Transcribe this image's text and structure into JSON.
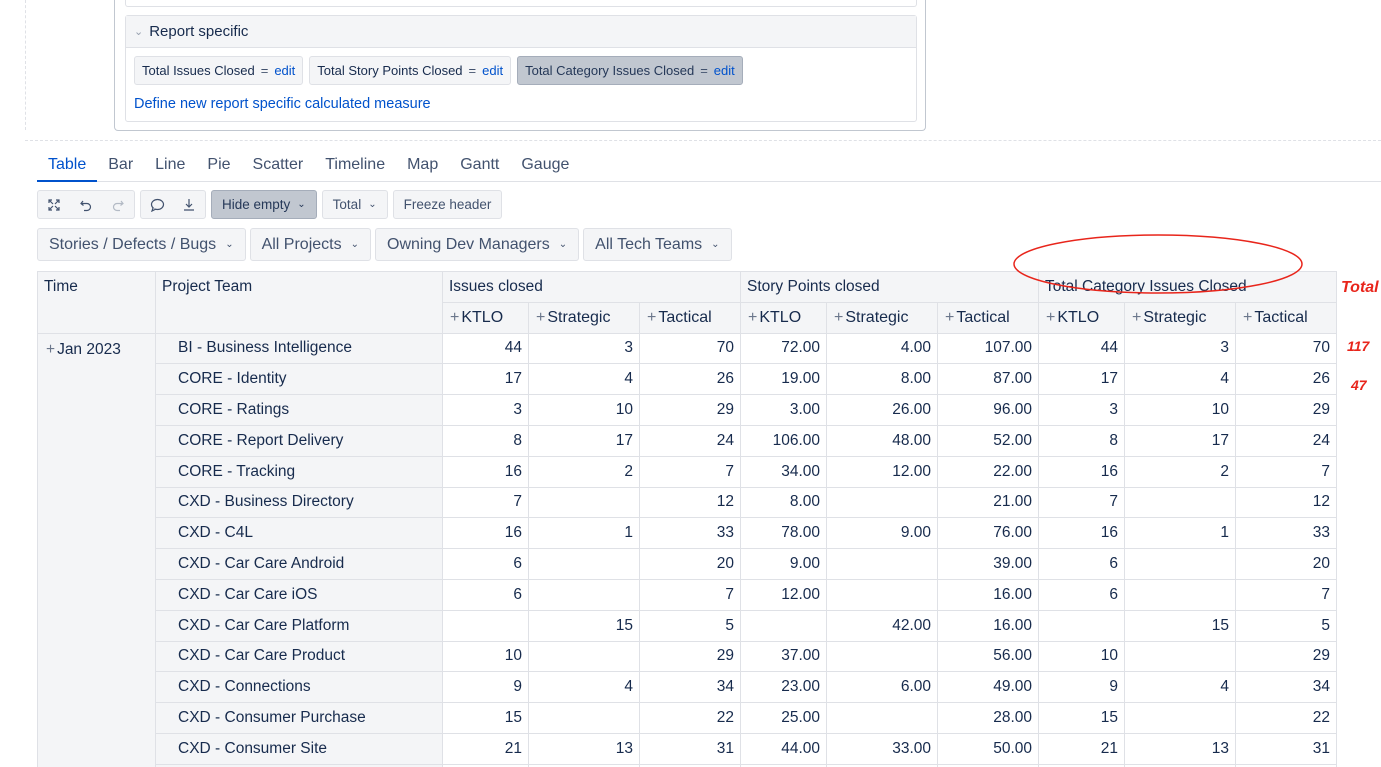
{
  "report_specific": {
    "header": "Report specific",
    "measures": [
      {
        "name": "Total Issues Closed",
        "eq": "=",
        "edit": "edit",
        "selected": false
      },
      {
        "name": "Total Story Points Closed",
        "eq": "=",
        "edit": "edit",
        "selected": false
      },
      {
        "name": "Total Category Issues Closed",
        "eq": "=",
        "edit": "edit",
        "selected": true
      }
    ],
    "define_link": "Define new report specific calculated measure"
  },
  "tabs": [
    "Table",
    "Bar",
    "Line",
    "Pie",
    "Scatter",
    "Timeline",
    "Map",
    "Gantt",
    "Gauge"
  ],
  "active_tab": "Table",
  "toolbar": {
    "icons": [
      "expand-icon",
      "undo-icon",
      "redo-icon",
      "comment-icon",
      "download-icon"
    ],
    "hide_empty": "Hide empty",
    "total": "Total",
    "freeze_header": "Freeze header"
  },
  "filters": [
    "Stories / Defects / Bugs",
    "All Projects",
    "Owning Dev Managers",
    "All Tech Teams"
  ],
  "table": {
    "col_time": "Time",
    "col_team": "Project Team",
    "groups": [
      "Issues closed",
      "Story Points closed",
      "Total Category Issues Closed"
    ],
    "sub_cols": [
      "KTLO",
      "Strategic",
      "Tactical"
    ],
    "time_value": "Jan 2023",
    "rows": [
      {
        "team": "BI - Business Intelligence",
        "v": [
          "44",
          "3",
          "70",
          "72.00",
          "4.00",
          "107.00",
          "44",
          "3",
          "70"
        ]
      },
      {
        "team": "CORE - Identity",
        "v": [
          "17",
          "4",
          "26",
          "19.00",
          "8.00",
          "87.00",
          "17",
          "4",
          "26"
        ]
      },
      {
        "team": "CORE - Ratings",
        "v": [
          "3",
          "10",
          "29",
          "3.00",
          "26.00",
          "96.00",
          "3",
          "10",
          "29"
        ]
      },
      {
        "team": "CORE - Report Delivery",
        "v": [
          "8",
          "17",
          "24",
          "106.00",
          "48.00",
          "52.00",
          "8",
          "17",
          "24"
        ]
      },
      {
        "team": "CORE - Tracking",
        "v": [
          "16",
          "2",
          "7",
          "34.00",
          "12.00",
          "22.00",
          "16",
          "2",
          "7"
        ]
      },
      {
        "team": "CXD - Business Directory",
        "v": [
          "7",
          "",
          "12",
          "8.00",
          "",
          "21.00",
          "7",
          "",
          "12"
        ]
      },
      {
        "team": "CXD - C4L",
        "v": [
          "16",
          "1",
          "33",
          "78.00",
          "9.00",
          "76.00",
          "16",
          "1",
          "33"
        ]
      },
      {
        "team": "CXD - Car Care Android",
        "v": [
          "6",
          "",
          "20",
          "9.00",
          "",
          "39.00",
          "6",
          "",
          "20"
        ]
      },
      {
        "team": "CXD - Car Care iOS",
        "v": [
          "6",
          "",
          "7",
          "12.00",
          "",
          "16.00",
          "6",
          "",
          "7"
        ]
      },
      {
        "team": "CXD - Car Care Platform",
        "v": [
          "",
          "15",
          "5",
          "",
          "42.00",
          "16.00",
          "",
          "15",
          "5"
        ]
      },
      {
        "team": "CXD - Car Care Product",
        "v": [
          "10",
          "",
          "29",
          "37.00",
          "",
          "56.00",
          "10",
          "",
          "29"
        ]
      },
      {
        "team": "CXD - Connections",
        "v": [
          "9",
          "4",
          "34",
          "23.00",
          "6.00",
          "49.00",
          "9",
          "4",
          "34"
        ]
      },
      {
        "team": "CXD - Consumer Purchase",
        "v": [
          "15",
          "",
          "22",
          "25.00",
          "",
          "28.00",
          "15",
          "",
          "22"
        ]
      },
      {
        "team": "CXD - Consumer Site",
        "v": [
          "21",
          "13",
          "31",
          "44.00",
          "33.00",
          "50.00",
          "21",
          "13",
          "31"
        ]
      }
    ]
  },
  "annotations": {
    "total": "Total",
    "row1": "117",
    "row2": "47",
    "color": "#e8251b"
  }
}
